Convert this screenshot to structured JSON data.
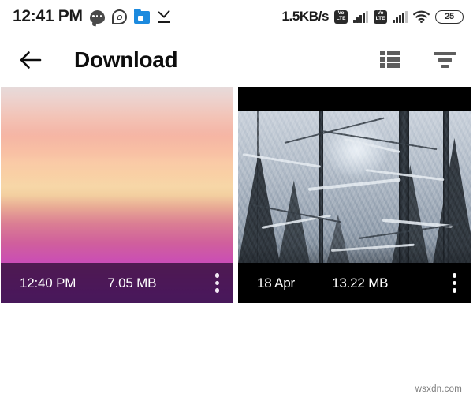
{
  "status_bar": {
    "clock": "12:41 PM",
    "network_speed": "1.5KB/s",
    "battery_level": "25",
    "volte_top": "Vo",
    "volte_bottom": "LTE",
    "icons": [
      "chat-bubble-icon",
      "whatsapp-icon",
      "file-manager-icon",
      "download-complete-icon"
    ]
  },
  "app_bar": {
    "title": "Download",
    "back_label": "Back",
    "view_toggle_label": "List view",
    "sort_label": "Sort"
  },
  "grid": {
    "items": [
      {
        "name": "sunset-thumbnail",
        "time": "12:40 PM",
        "size": "7.05 MB",
        "menu_label": "More options"
      },
      {
        "name": "snow-forest-thumbnail",
        "time": "18 Apr",
        "size": "13.22 MB",
        "menu_label": "More options"
      }
    ]
  },
  "footer": {
    "watermark": "wsxdn.com"
  },
  "colors": {
    "accent_blue": "#1c8ade",
    "text_primary": "#0d0d0d",
    "icon_grey": "#5e5e5e",
    "overlay_purple": "#1e082a",
    "overlay_black": "#000000"
  }
}
